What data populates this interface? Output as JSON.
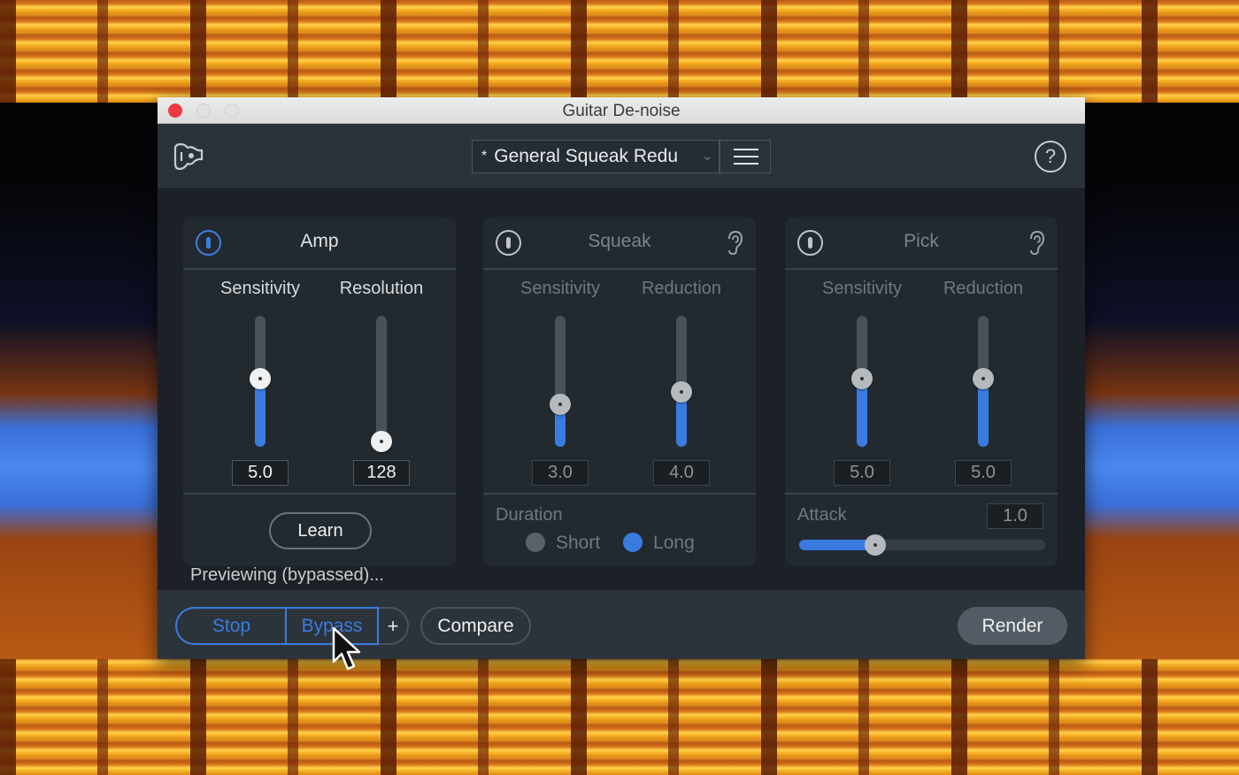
{
  "window": {
    "title": "Guitar De-noise"
  },
  "header": {
    "logo_icon": "guitar-icon",
    "preset": {
      "modified_marker": "*",
      "value": "General Squeak Redu",
      "chevron_icon": "chevron-down-icon"
    },
    "menu_icon": "hamburger-menu-icon",
    "help_icon": "help-icon",
    "help_glyph": "?"
  },
  "modules": [
    {
      "title": "Amp",
      "enabled": true,
      "sliders": [
        {
          "label": "Sensitivity",
          "value": "5.0",
          "fraction": 0.52
        },
        {
          "label": "Resolution",
          "value": "128",
          "fraction": 0.0
        }
      ],
      "learn_label": "Learn"
    },
    {
      "title": "Squeak",
      "enabled": false,
      "listen_icon": "ear-icon",
      "sliders": [
        {
          "label": "Sensitivity",
          "value": "3.0",
          "fraction": 0.31
        },
        {
          "label": "Reduction",
          "value": "4.0",
          "fraction": 0.41
        }
      ],
      "duration": {
        "label": "Duration",
        "options": [
          "Short",
          "Long"
        ],
        "selected": "Long"
      }
    },
    {
      "title": "Pick",
      "enabled": false,
      "listen_icon": "ear-icon",
      "sliders": [
        {
          "label": "Sensitivity",
          "value": "5.0",
          "fraction": 0.52
        },
        {
          "label": "Reduction",
          "value": "5.0",
          "fraction": 0.52
        }
      ],
      "attack": {
        "label": "Attack",
        "value": "1.0",
        "fraction": 0.31
      }
    }
  ],
  "status": "Previewing (bypassed)...",
  "footer": {
    "stop_label": "Stop",
    "bypass_label": "Bypass",
    "plus_label": "+",
    "compare_label": "Compare",
    "render_label": "Render"
  },
  "colors": {
    "accent": "#3a7be0",
    "close_button": "#ec3a45",
    "spectrogram": "#f6b227",
    "waveform": "#4a88ee"
  }
}
